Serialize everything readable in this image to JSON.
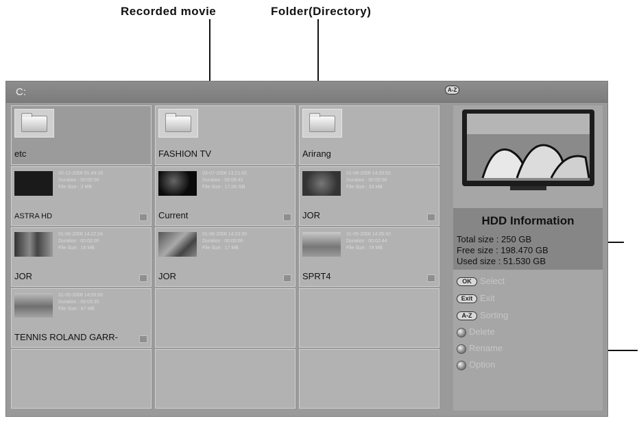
{
  "callouts": {
    "recorded_movie": "Recorded movie",
    "folder": "Folder(Directory)"
  },
  "titlebar": {
    "drive": "C:",
    "sort_badge": "A-Z"
  },
  "folders": [
    {
      "name": "etc"
    },
    {
      "name": "FASHION TV"
    },
    {
      "name": "Arirang"
    }
  ],
  "recordings": [
    {
      "datetime": "20-12-2006 01:49:16",
      "duration": "Duration : 00:00:00",
      "size": "File Size : 3 MB",
      "name": "ASTRA HD"
    },
    {
      "datetime": "03-07-2008 13:21:42",
      "duration": "Duration : 06:09:42",
      "size": "File Size : 17.06 GB",
      "name": "Current"
    },
    {
      "datetime": "01-08-2008 14:20:52",
      "duration": "Duration : 00:00:00",
      "size": "File Size : 33 MB",
      "name": "JOR"
    },
    {
      "datetime": "01-08-2008 14:22:24",
      "duration": "Duration : 00:00:00",
      "size": "File Size : 16 MB",
      "name": "JOR"
    },
    {
      "datetime": "01-08-2008 14:23:30",
      "duration": "Duration : 00:00:00",
      "size": "File Size : 17 MB",
      "name": "JOR"
    },
    {
      "datetime": "31-05-2008 14:05:42",
      "duration": "Duration : 00:02:44",
      "size": "File Size : 79 MB",
      "name": "SPRT4"
    },
    {
      "datetime": "31-05-2008 14:05:56",
      "duration": "Duration : 00:03:30",
      "size": "File Size : 87 MB",
      "name": "TENNIS ROLAND GARR-"
    }
  ],
  "hdd": {
    "title": "HDD Information",
    "total": "Total size : 250 GB",
    "free": "Free size : 198.470 GB",
    "used": "Used size : 51.530 GB"
  },
  "actions": {
    "ok_key": "OK",
    "ok_label": "Select",
    "exit_key": "Exit",
    "exit_label": "Exit",
    "az_key": "A-Z",
    "az_label": "Sorting",
    "delete_label": "Delete",
    "rename_label": "Rename",
    "option_label": "Option"
  },
  "colors": {
    "screen_bg": "#9a9a9a",
    "panel_bg": "#a6a6a6",
    "cell_bg": "#b2b2b2",
    "selected_bg": "#9b9b9b"
  }
}
